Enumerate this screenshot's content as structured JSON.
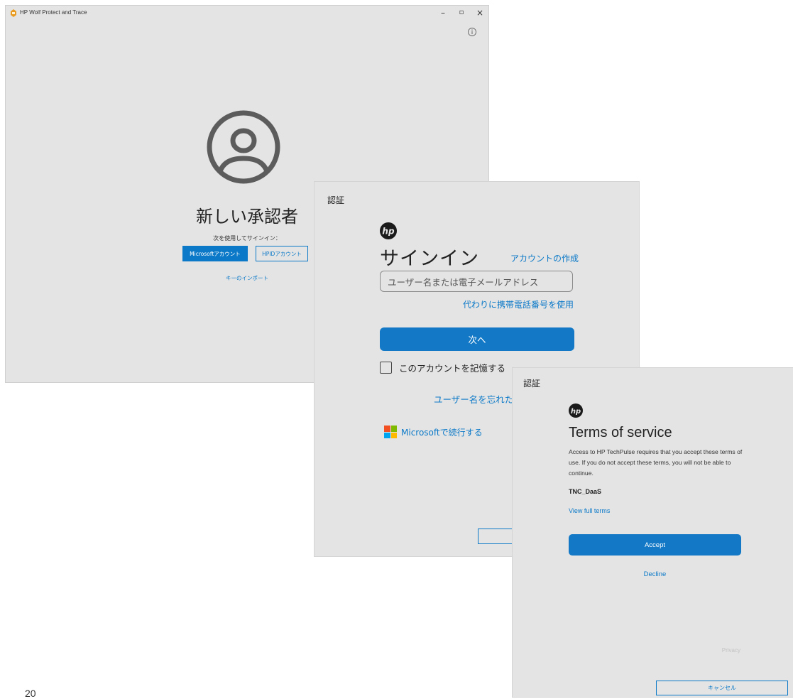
{
  "win1": {
    "title": "HP Wolf Protect and Trace",
    "controls": {
      "minimize": "–",
      "maximize": "▫",
      "close": "×"
    },
    "icons": {
      "app": "hp-wolf-app-icon",
      "info": "info-icon",
      "avatar": "user-avatar-icon"
    },
    "heading": "新しい承認者",
    "subtext": "次を使用してサインイン：",
    "microsoft_button": "Microsoftアカウント",
    "hpid_button": "HPIDアカウント",
    "key_import_link": "キーのインポート"
  },
  "win2": {
    "title": "認証",
    "signin_title": "サインイン",
    "create_account_link": "アカウントの作成",
    "username_placeholder": "ユーザー名または電子メールアドレス",
    "phone_link": "代わりに携帯電話番号を使用",
    "next_button": "次へ",
    "remember_label": "このアカウントを記憶する",
    "forgot_link": "ユーザー名を忘れた場",
    "microsoft_continue": "Microsoftで続行する"
  },
  "win3": {
    "title": "認証",
    "tos_title": "Terms of service",
    "tos_body": "Access to HP TechPulse requires that you accept these terms of use. If you do not accept these terms, you will not be able to continue.",
    "tos_name": "TNC_DaaS",
    "view_terms_link": "View full terms",
    "accept_button": "Accept",
    "decline_link": "Decline",
    "privacy": "Privacy",
    "cancel_button": "キャンセル"
  },
  "colors": {
    "accent": "#0b79c8",
    "window_bg": "#e4e4e4"
  },
  "page_number": "20"
}
